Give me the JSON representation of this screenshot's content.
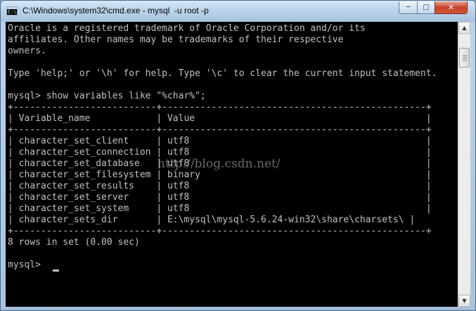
{
  "window": {
    "title": "C:\\Windows\\system32\\cmd.exe - mysql  -u root -p",
    "app_icon_glyph": "C:\\",
    "controls": {
      "minimize": "─",
      "maximize": "□",
      "close": "✕"
    }
  },
  "console": {
    "lines": [
      "Oracle is a registered trademark of Oracle Corporation and/or its",
      "affiliates. Other names may be trademarks of their respective",
      "owners.",
      "",
      "Type 'help;' or '\\h' for help. Type '\\c' to clear the current input statement.",
      "",
      "mysql> show variables like \"%char%\";",
      "+--------------------------+------------------------------------------------+",
      "| Variable_name            | Value                                          |",
      "+--------------------------+------------------------------------------------+",
      "| character_set_client     | utf8                                           |",
      "| character_set_connection | utf8                                           |",
      "| character_set_database   | utf8                                           |",
      "| character_set_filesystem | binary                                         |",
      "| character_set_results    | utf8                                           |",
      "| character_set_server     | utf8                                           |",
      "| character_set_system     | utf8                                           |",
      "| character_sets_dir       | E:\\mysql\\mysql-5.6.24-win32\\share\\charsets\\ |",
      "+--------------------------+------------------------------------------------+",
      "8 rows in set (0.00 sec)",
      "",
      "mysql> "
    ],
    "watermark": "http://blog.csdn.net/"
  },
  "scrollbar": {
    "up_arrow": "▲",
    "down_arrow": "▼"
  },
  "colors": {
    "console_bg": "#000000",
    "console_text": "#c0c0c0",
    "title_bar": "#bcd3ea"
  }
}
